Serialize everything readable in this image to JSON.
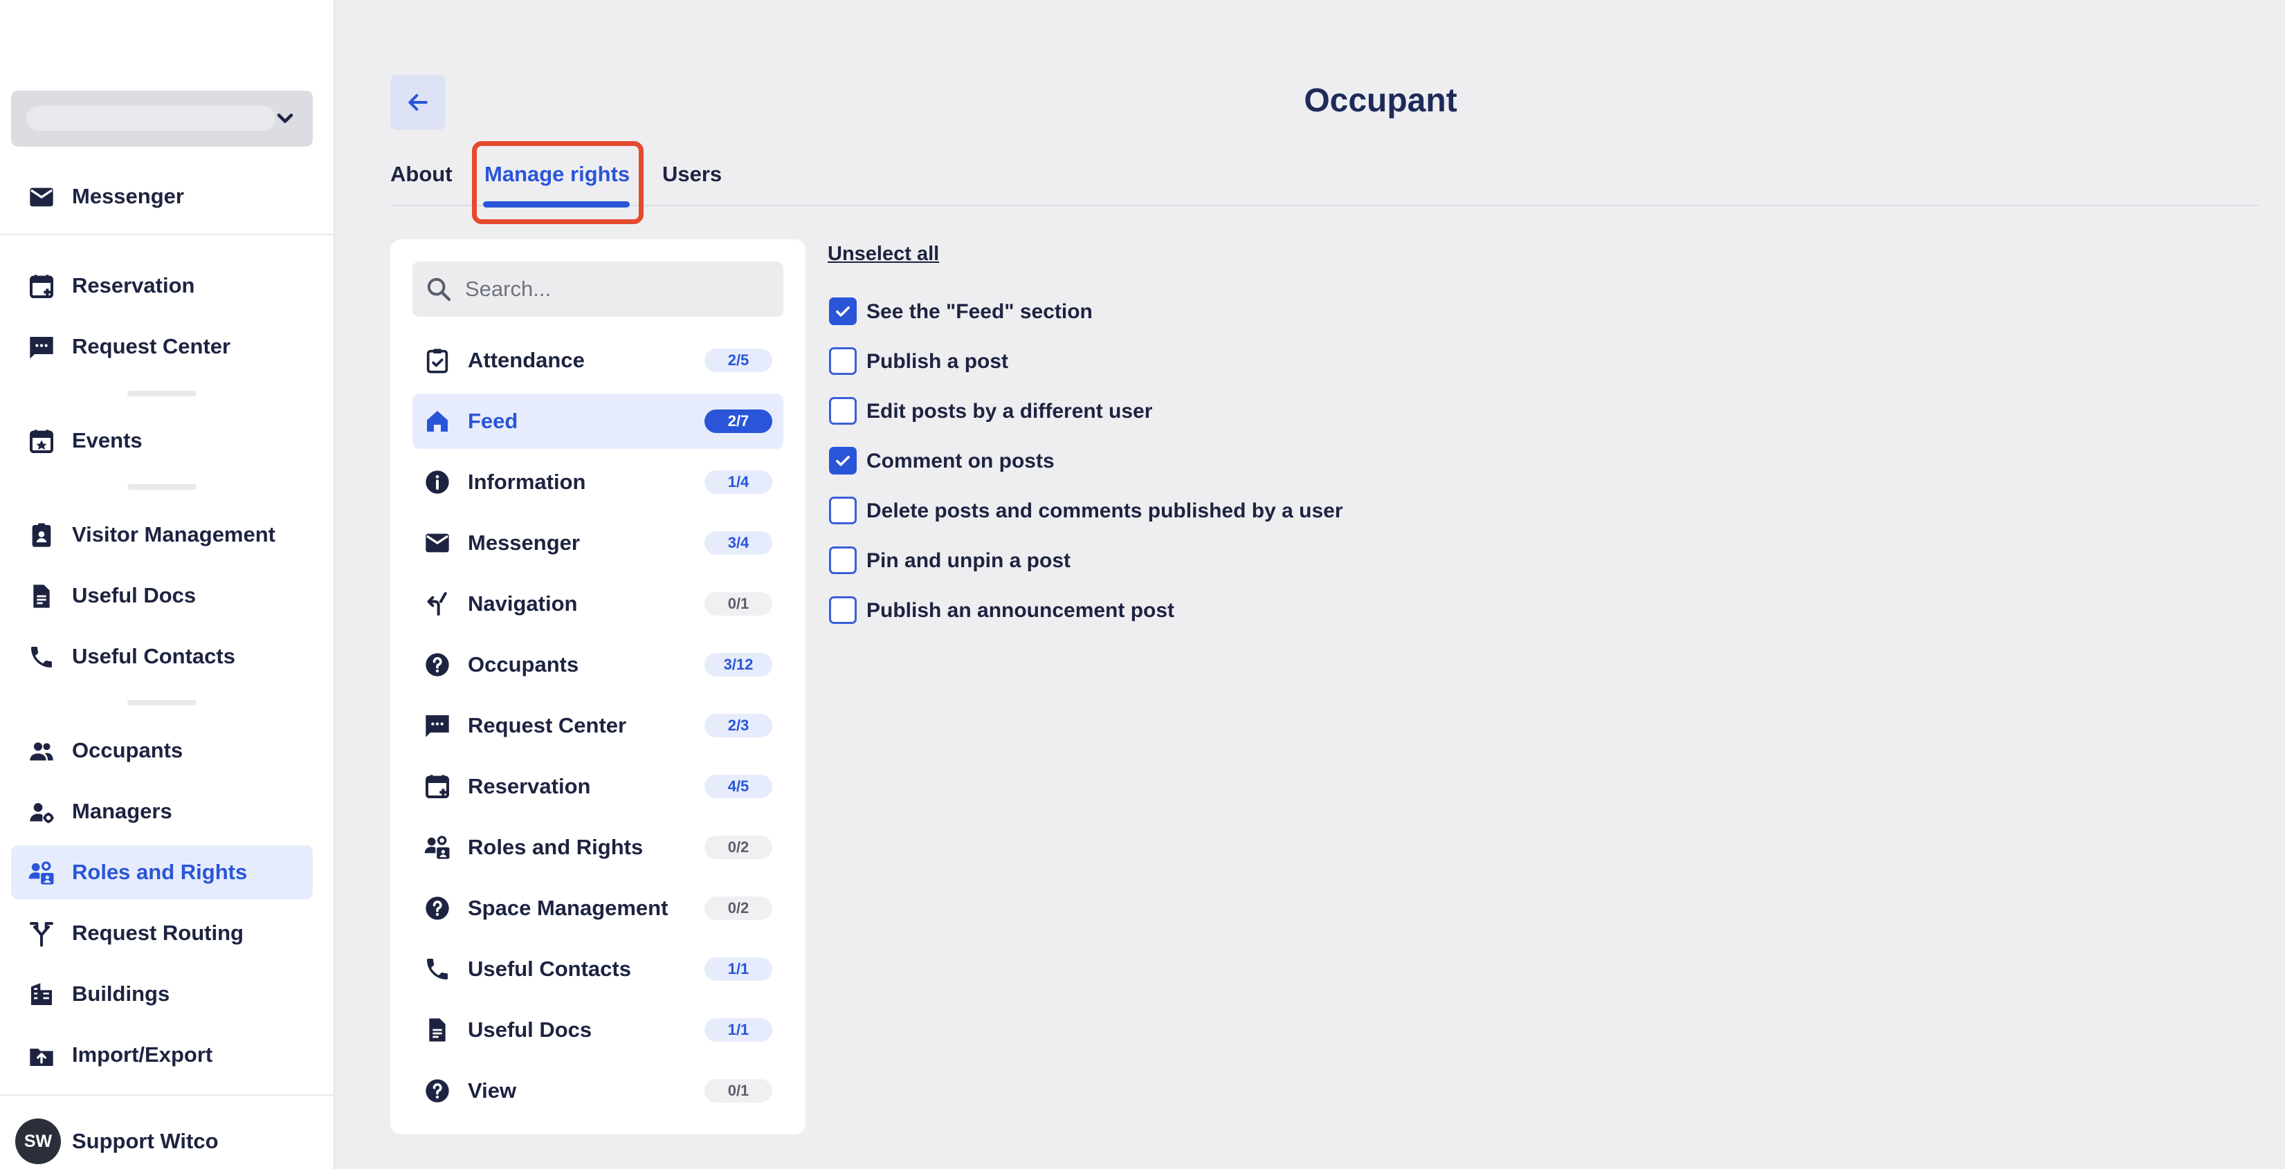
{
  "sidebar": {
    "items": [
      {
        "label": "Messenger",
        "icon": "mail-icon"
      },
      {
        "label": "Reservation",
        "icon": "calendar-plus-icon"
      },
      {
        "label": "Request Center",
        "icon": "chat-dots-icon"
      },
      {
        "label": "Events",
        "icon": "calendar-star-icon"
      },
      {
        "label": "Visitor Management",
        "icon": "badge-icon"
      },
      {
        "label": "Useful Docs",
        "icon": "document-icon"
      },
      {
        "label": "Useful Contacts",
        "icon": "phone-icon"
      },
      {
        "label": "Occupants",
        "icon": "people-icon"
      },
      {
        "label": "Managers",
        "icon": "user-gear-icon"
      },
      {
        "label": "Roles and Rights",
        "icon": "roles-icon"
      },
      {
        "label": "Request Routing",
        "icon": "routing-icon"
      },
      {
        "label": "Buildings",
        "icon": "building-icon"
      },
      {
        "label": "Import/Export",
        "icon": "upload-icon"
      }
    ],
    "user": {
      "initials": "SW",
      "name": "Support Witco"
    }
  },
  "header": {
    "title": "Occupant",
    "tabs": [
      {
        "label": "About"
      },
      {
        "label": "Manage rights"
      },
      {
        "label": "Users"
      }
    ],
    "active_tab": "Manage rights"
  },
  "categories": {
    "search_placeholder": "Search...",
    "items": [
      {
        "label": "Attendance",
        "count": "2/5",
        "icon": "clipboard-check-icon"
      },
      {
        "label": "Feed",
        "count": "2/7",
        "icon": "home-icon"
      },
      {
        "label": "Information",
        "count": "1/4",
        "icon": "info-icon"
      },
      {
        "label": "Messenger",
        "count": "3/4",
        "icon": "mail-icon"
      },
      {
        "label": "Navigation",
        "count": "0/1",
        "icon": "turn-arrow-icon"
      },
      {
        "label": "Occupants",
        "count": "3/12",
        "icon": "question-icon"
      },
      {
        "label": "Request Center",
        "count": "2/3",
        "icon": "chat-dots-icon"
      },
      {
        "label": "Reservation",
        "count": "4/5",
        "icon": "calendar-plus-icon"
      },
      {
        "label": "Roles and Rights",
        "count": "0/2",
        "icon": "roles-icon"
      },
      {
        "label": "Space Management",
        "count": "0/2",
        "icon": "question-icon"
      },
      {
        "label": "Useful Contacts",
        "count": "1/1",
        "icon": "phone-icon"
      },
      {
        "label": "Useful Docs",
        "count": "1/1",
        "icon": "document-icon"
      },
      {
        "label": "View",
        "count": "0/1",
        "icon": "question-icon"
      }
    ],
    "selected": "Feed"
  },
  "permissions": {
    "unselect_all": "Unselect all",
    "items": [
      {
        "label": "See the \"Feed\" section",
        "checked": true
      },
      {
        "label": "Publish a post",
        "checked": false
      },
      {
        "label": "Edit posts by a different user",
        "checked": false
      },
      {
        "label": "Comment on posts",
        "checked": true
      },
      {
        "label": "Delete posts and comments published by a user",
        "checked": false
      },
      {
        "label": "Pin and unpin a post",
        "checked": false
      },
      {
        "label": "Publish an announcement post",
        "checked": false
      }
    ]
  },
  "colors": {
    "accent": "#2a55d8",
    "highlight": "#e64a2e",
    "background": "#eeeef1"
  }
}
